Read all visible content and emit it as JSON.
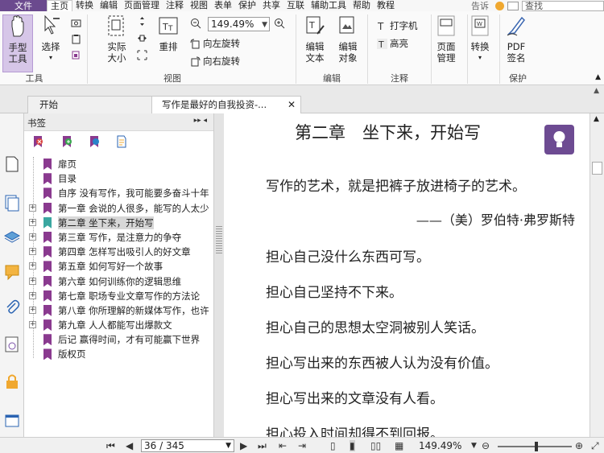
{
  "menu": {
    "file": "文件",
    "items": [
      "主页",
      "转换",
      "编辑",
      "页面管理",
      "注释",
      "视图",
      "表单",
      "保护",
      "共享",
      "互联",
      "辅助工具",
      "帮助",
      "教程"
    ],
    "active_index": 0,
    "tell_me": "告诉",
    "search_placeholder": "查找"
  },
  "ribbon": {
    "hand_tool": "手型\n工具",
    "select": "选择",
    "actual_size": "实际\n大小",
    "reflow": "重排",
    "zoom_value": "149.49%",
    "rotate_left": "向左旋转",
    "rotate_right": "向右旋转",
    "edit_text": "编辑\n文本",
    "edit_object": "编辑\n对象",
    "typewriter": "打字机",
    "highlight": "高亮",
    "page_manage": "页面\n管理",
    "convert": "转换",
    "pdf_sign": "PDF\n签名",
    "groups": {
      "tools": "工具",
      "view": "视图",
      "edit": "编辑",
      "comment": "注释",
      "protect": "保护"
    }
  },
  "tabs": [
    {
      "label": "开始",
      "active": false
    },
    {
      "label": "写作是最好的自我投资-...",
      "active": true
    }
  ],
  "bookmarks": {
    "title": "书签",
    "items": [
      {
        "label": "扉页",
        "expandable": false,
        "selected": false
      },
      {
        "label": "目录",
        "expandable": false,
        "selected": false
      },
      {
        "label": "自序 没有写作，我可能要多奋斗十年",
        "expandable": false,
        "selected": false
      },
      {
        "label": "第一章 会说的人很多，能写的人太少",
        "expandable": true,
        "selected": false
      },
      {
        "label": "第二章 坐下来，开始写",
        "expandable": true,
        "selected": true
      },
      {
        "label": "第三章 写作，是注意力的争夺",
        "expandable": true,
        "selected": false
      },
      {
        "label": "第四章 怎样写出吸引人的好文章",
        "expandable": true,
        "selected": false
      },
      {
        "label": "第五章 如何写好一个故事",
        "expandable": true,
        "selected": false
      },
      {
        "label": "第六章 如何训练你的逻辑思维",
        "expandable": true,
        "selected": false
      },
      {
        "label": "第七章 职场专业文章写作的方法论",
        "expandable": true,
        "selected": false
      },
      {
        "label": "第八章 你所理解的新媒体写作，也许",
        "expandable": true,
        "selected": false
      },
      {
        "label": "第九章 人人都能写出爆款文",
        "expandable": true,
        "selected": false
      },
      {
        "label": "后记 赢得时间，才有可能赢下世界",
        "expandable": false,
        "selected": false
      },
      {
        "label": "版权页",
        "expandable": false,
        "selected": false
      }
    ]
  },
  "document": {
    "chapter_title": "第二章　坐下来，开始写",
    "quote": "写作的艺术，就是把裤子放进椅子的艺术。",
    "author": "——（美）罗伯特·弗罗斯特",
    "lines": [
      "担心自己没什么东西可写。",
      "担心自己坚持不下来。",
      "担心自己的思想太空洞被别人笑话。",
      "担心写出来的东西被人认为没有价值。",
      "担心写出来的文章没有人看。",
      "担心投入时间却得不到回报。"
    ]
  },
  "status": {
    "page": "36 / 345",
    "zoom": "149.49%"
  },
  "colors": {
    "brand": "#6b4a8e",
    "bookmark": "#8a3a8f",
    "bookmark_selected": "#3aa7a0"
  }
}
